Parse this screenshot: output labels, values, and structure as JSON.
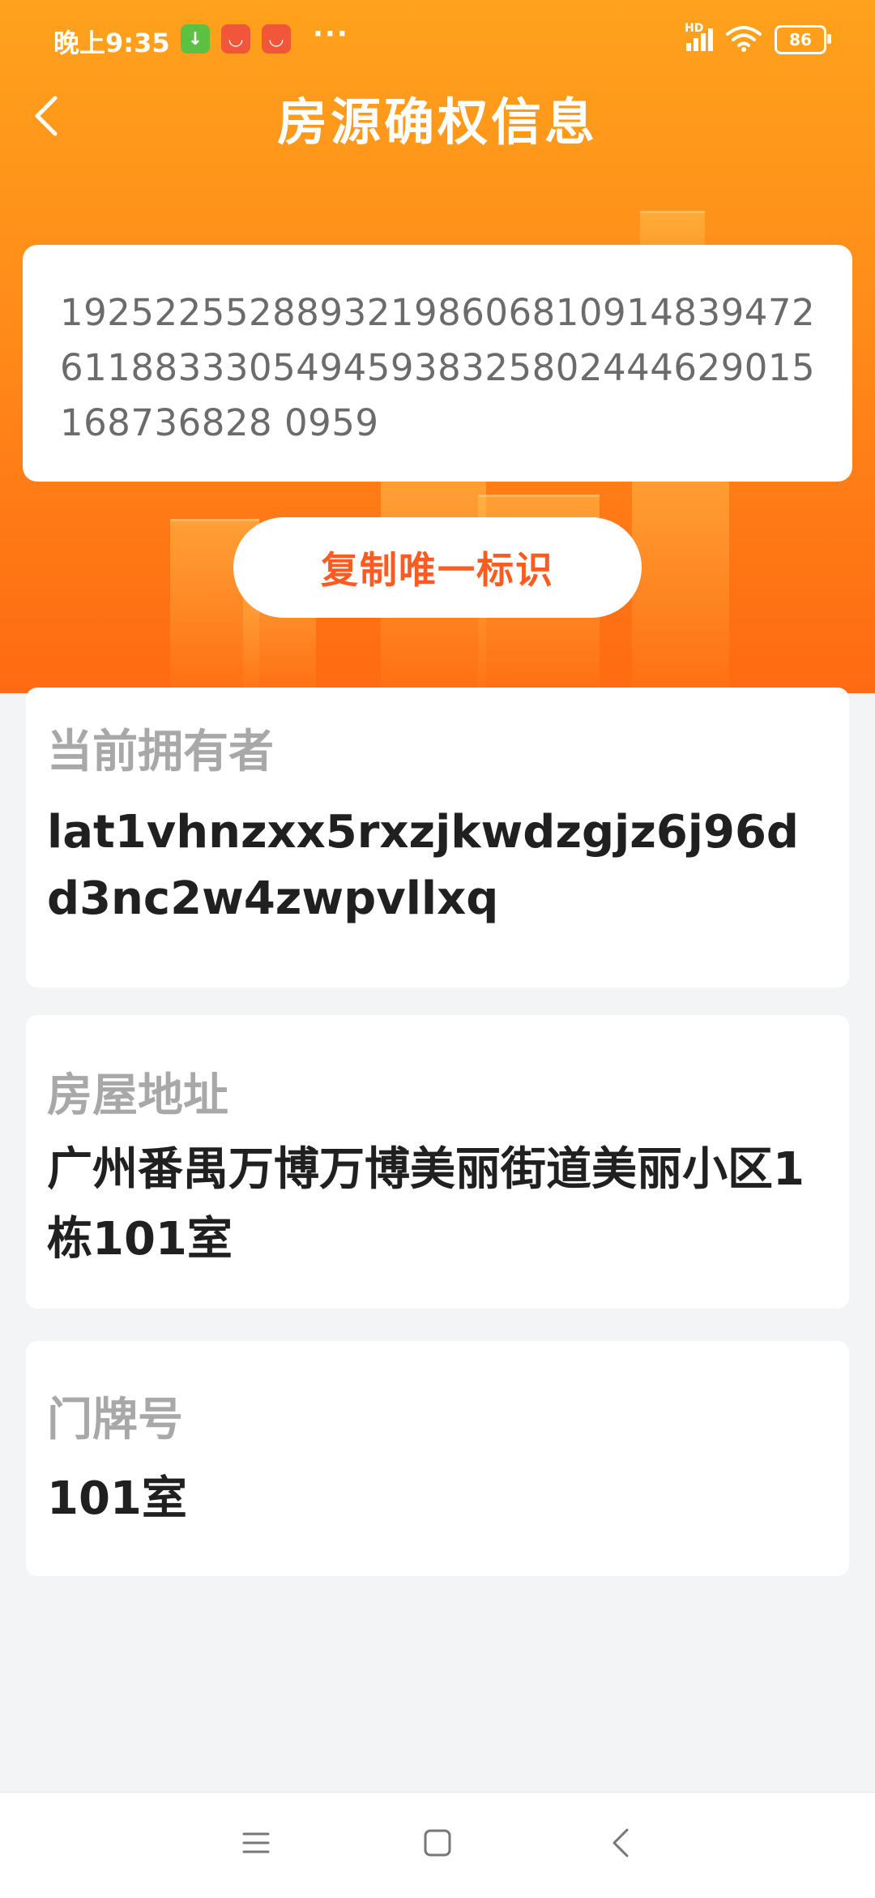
{
  "status_bar": {
    "time": "晚上9:35",
    "more": "···",
    "signal_label": "HD",
    "battery": "86"
  },
  "header": {
    "title": "房源确权信息",
    "unique_id": "1925225528893219860681091483947261188333054945938325802444629015168736828 0959",
    "copy_button": "复制唯一标识"
  },
  "owner": {
    "label": "当前拥有者",
    "value": "lat1vhnzxx5rxzjkwdzgjz6j96dd3nc2w4zwpvllxq"
  },
  "address": {
    "label": "房屋地址",
    "value": "广州番禺万博万博美丽街道美丽小区1栋101室"
  },
  "door": {
    "label": "门牌号",
    "value": "101室"
  },
  "colors": {
    "header_start": "#ffa21c",
    "header_end": "#ff6a12",
    "accent_text": "#ff5a1f",
    "page_bg": "#f3f4f6"
  },
  "icons": {
    "back": "chevron-left-icon",
    "nav_menu": "menu-icon",
    "nav_home": "square-icon",
    "nav_back": "chevron-left-icon"
  }
}
